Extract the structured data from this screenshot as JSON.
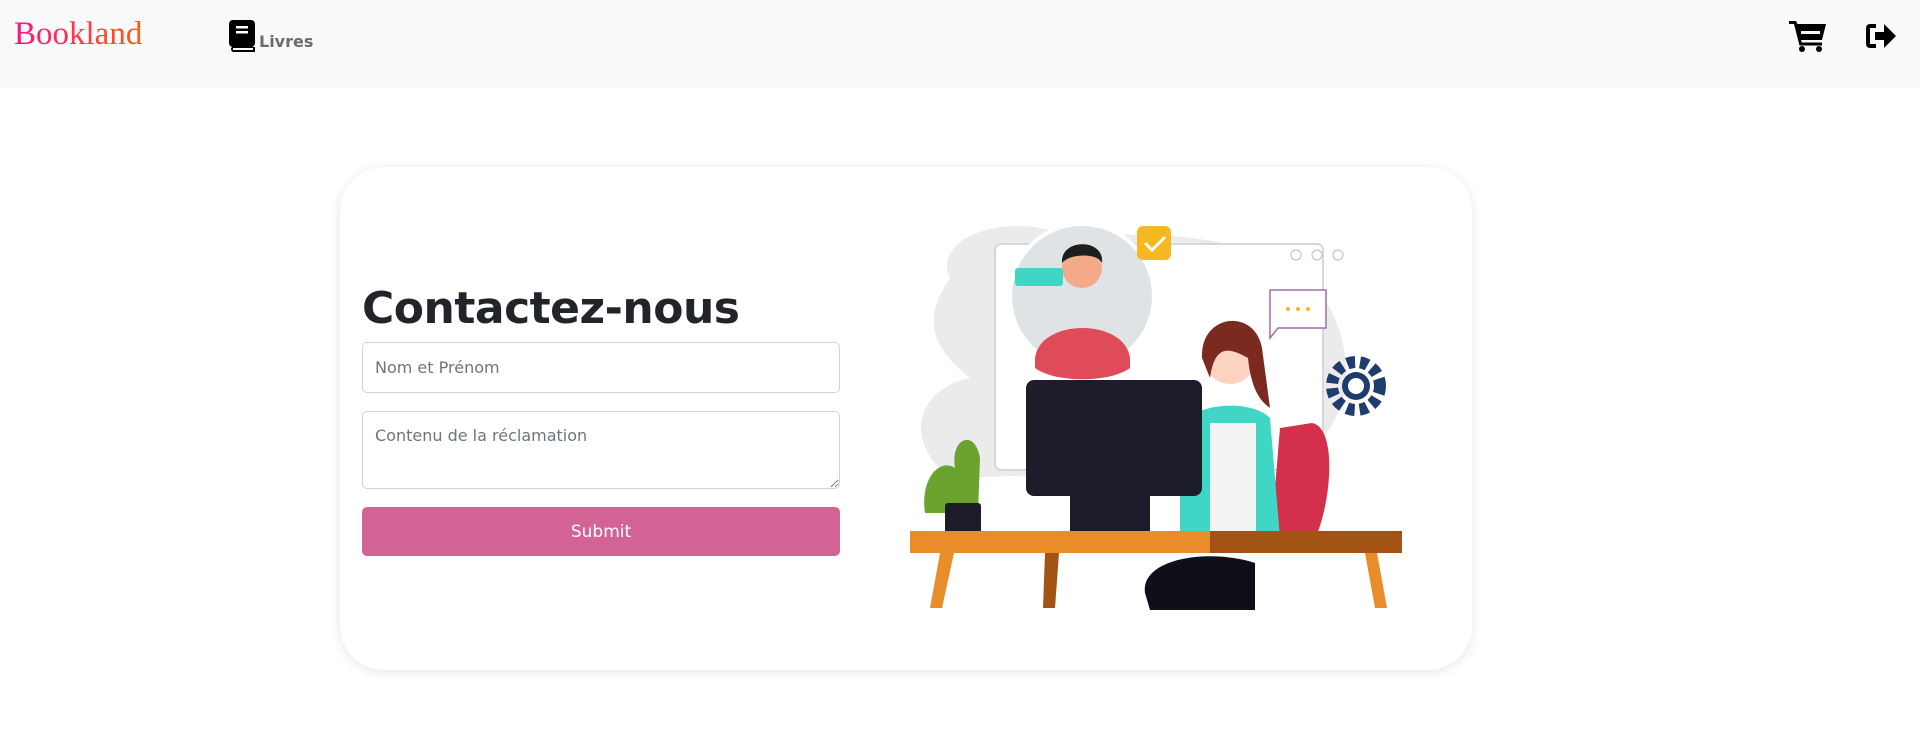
{
  "navbar": {
    "brand": "Bookland",
    "links": [
      {
        "label": "Livres",
        "icon": "book-icon"
      }
    ],
    "actions": [
      {
        "icon": "cart-icon"
      },
      {
        "icon": "logout-icon"
      }
    ]
  },
  "contact": {
    "title": "Contactez-nous",
    "name_placeholder": "Nom et Prénom",
    "message_placeholder": "Contenu de la réclamation",
    "submit_label": "Submit"
  },
  "colors": {
    "brand_gradient_start": "#ff1282",
    "brand_gradient_end": "#ff5a10",
    "submit": "#d36295",
    "navbar_bg": "#f8f9fa"
  }
}
